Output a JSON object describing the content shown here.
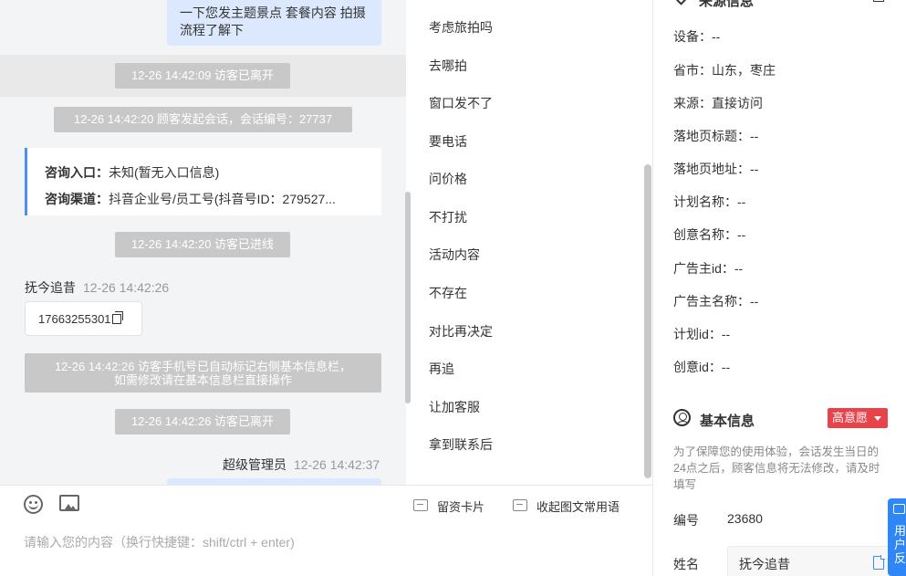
{
  "chat": {
    "top_bubble": "一下您发主题景点 套餐内容 拍摄流程了解下",
    "sys_left_1": "12-26 14:42:09 访客已离开",
    "sys_session": "12-26 14:42:20 顾客发起会话，会话编号：27737",
    "entry_label": "咨询入口：",
    "entry_value": "未知(暂无入口信息)",
    "channel_label": "咨询渠道：",
    "channel_value": "抖音企业号/员工号(抖音号ID：279527...",
    "sys_enter": "12-26 14:42:20 访客已进线",
    "visitor_name": "抚今追昔",
    "visitor_time": "12-26 14:42:26",
    "phone": "17663255301",
    "sys_phone_line1": "12-26 14:42:26 访客手机号已自动标记右侧基本信息栏，",
    "sys_phone_line2": "如需修改请在基本信息栏直接操作",
    "sys_left_2": "12-26 14:42:26 访客已离开",
    "admin_name": "超级管理员",
    "admin_time": "12-26 14:42:37"
  },
  "phrases": [
    "考虑旅拍吗",
    "去哪拍",
    "窗口发不了",
    "要电话",
    "问价格",
    "不打扰",
    "活动内容",
    "不存在",
    "对比再决定",
    "再追",
    "让加客服",
    "拿到联系后"
  ],
  "input": {
    "emoji_icon": "smile-icon",
    "image_icon": "image-icon",
    "card_label": "留资卡片",
    "collapse_label": "收起图文常用语",
    "placeholder": "请输入您的内容（换行快捷键：shift/ctrl + enter)"
  },
  "source": {
    "title": "来源信息",
    "rows": [
      "设备：--",
      "省市：山东，枣庄",
      "来源：直接访问",
      "落地页标题：--",
      "落地页地址：--",
      "计划名称：--",
      "创意名称：--",
      "广告主id：--",
      "广告主名称：--",
      "计划id：--",
      "创意id：--"
    ]
  },
  "basic": {
    "title": "基本信息",
    "badge": "高意愿",
    "notice": "为了保障您的使用体验，会话发生当日的24点之后，顾客信息将无法修改，请及时填写",
    "id_label": "编号",
    "id_value": "23680",
    "name_label": "姓名",
    "name_value": "抚今追昔"
  },
  "feedback": {
    "label": "用户反"
  },
  "colors": {
    "accent": "#2f86f6",
    "badge": "#e8424b",
    "chat_bg": "#f3f4f6",
    "bubble": "#dbe8fd"
  }
}
